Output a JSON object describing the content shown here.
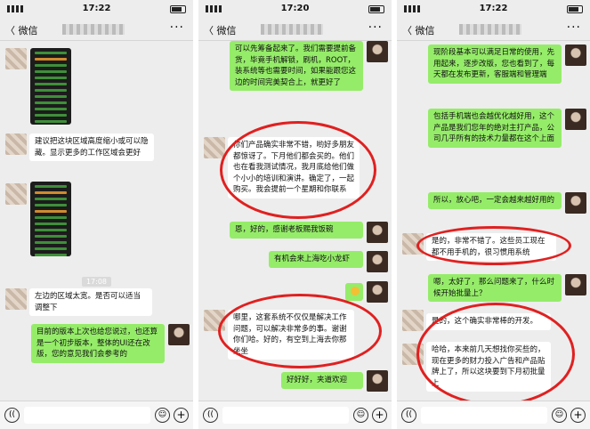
{
  "phones": [
    {
      "time": "17:22",
      "back_label": "〈 微信",
      "more_label": "···",
      "messages": {
        "m1": "建议把这块区域高度缩小或可以隐藏。显示更多的工作区域会更好",
        "ts1": "17:08",
        "m2": "左边的区域太宽。是否可以适当调整下",
        "m3": "目前的版本上次也给您说过，也还算是一个初步版本，整体的UI还在改版，您的意见我们会参考的"
      }
    },
    {
      "time": "17:20",
      "back_label": "〈 微信",
      "more_label": "···",
      "messages": {
        "m1": "可以先筹备起来了。我们需要提前备货，毕竟手机解锁，刷机，ROOT，装系统等也需要时间，如果能跟您这边的时间完美契合上，就更好了",
        "m2": "你们产品确实非常不错，哟好多朋友都惊讶了。下月他们都会买的。他们也在看我测试情况，我月底给他们做个小小的培训和演讲。确定了，一起购买。我会提前一个星期和你联系",
        "m3": "恩，好的，感谢老板赐我饭碗",
        "m4": "有机会来上海吃小龙虾",
        "m5": "哪里，这套系统不仅仅是解决工作问题，可以解决非常多的事。谢谢你们哈。好的，有空到上海去你那坐坐",
        "m6": "好好好，夹道欢迎"
      }
    },
    {
      "time": "17:22",
      "back_label": "〈 微信",
      "more_label": "···",
      "messages": {
        "m1": "现阶段基本可以满足日常的使用，先用起来，逐步改版，您也看到了，每天都在发布更新，客服端和管理端",
        "m2": "包括手机端也会越优化越好用，这个产品是我们您年的绝对主打产品，公司几乎所有的技术力量都在这个上面",
        "m3": "所以，放心吧，一定会越来越好用的",
        "m4": "是的，非常不错了。这些员工现在都不用手机的，很习惯用系统",
        "m5": "嗯，太好了，那么问题来了，什么时候开始批量上？",
        "m6": "是的，这个确实非常棒的开发。",
        "m7": "哈哈，本来前几天想找你买些的，现在更多的财力投入广告和产品贴牌上了，所以这块要到下月初批量上"
      }
    }
  ],
  "input_bar": {
    "voice_icon": "((",
    "emoji_icon": "☺",
    "plus_icon": "+"
  }
}
